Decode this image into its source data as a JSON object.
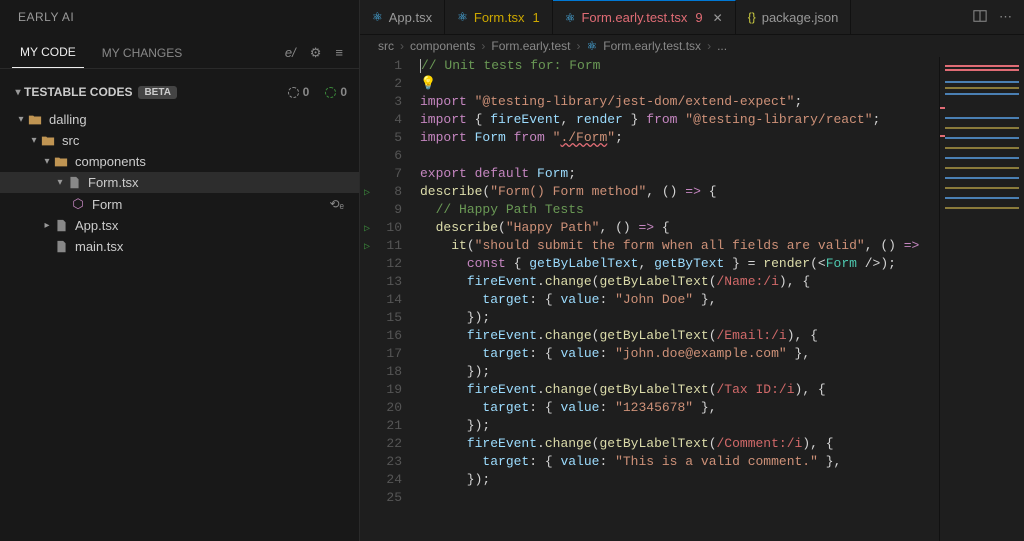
{
  "sidebar": {
    "title": "EARLY AI",
    "tabs": [
      {
        "label": "MY CODE",
        "active": true
      },
      {
        "label": "MY CHANGES",
        "active": false
      }
    ],
    "brand_glyph": "e/",
    "gear_icon": "⚙",
    "menu_icon": "≡",
    "section": {
      "title": "TESTABLE CODES",
      "badge": "BETA",
      "count_a": "0",
      "count_b": "0"
    },
    "tree": [
      {
        "label": "dalling",
        "kind": "folder",
        "depth": 1,
        "expanded": true
      },
      {
        "label": "src",
        "kind": "folder",
        "depth": 2,
        "expanded": true
      },
      {
        "label": "components",
        "kind": "folder",
        "depth": 3,
        "expanded": true
      },
      {
        "label": "Form.tsx",
        "kind": "file",
        "depth": 4,
        "expanded": true,
        "selected": true
      },
      {
        "label": "Form",
        "kind": "symbol",
        "depth": 5,
        "action": true
      },
      {
        "label": "App.tsx",
        "kind": "file",
        "depth": 3,
        "expanded": false,
        "collapsed_caret": true
      },
      {
        "label": "main.tsx",
        "kind": "file",
        "depth": 3
      }
    ]
  },
  "tabs": [
    {
      "label": "App.tsx",
      "icon": "react",
      "dirty": null
    },
    {
      "label": "Form.tsx",
      "icon": "react-mod",
      "dirty": "1"
    },
    {
      "label": "Form.early.test.tsx",
      "icon": "react-err",
      "dirty": "9",
      "active": true,
      "close": true
    },
    {
      "label": "package.json",
      "icon": "json"
    }
  ],
  "tabs_actions": {
    "split": "▣",
    "more": "⋯"
  },
  "breadcrumbs": [
    {
      "text": "src"
    },
    {
      "text": "components"
    },
    {
      "text": "Form.early.test"
    },
    {
      "text": "Form.early.test.tsx",
      "icon": "react-err"
    },
    {
      "text": "..."
    }
  ],
  "editor": {
    "lines": [
      {
        "n": 1,
        "tokens": [
          {
            "t": "// Unit tests for: Form",
            "c": "c-comment"
          }
        ],
        "cursor_before": true
      },
      {
        "n": 2,
        "tokens": [
          {
            "t": "💡",
            "c": "bulb"
          }
        ]
      },
      {
        "n": 3,
        "tokens": [
          {
            "t": "import ",
            "c": "c-kw"
          },
          {
            "t": "\"@testing-library/jest-dom/extend-expect\"",
            "c": "c-str"
          },
          {
            "t": ";",
            "c": "c-pun"
          }
        ]
      },
      {
        "n": 4,
        "tokens": [
          {
            "t": "import ",
            "c": "c-kw"
          },
          {
            "t": "{ ",
            "c": "c-pun"
          },
          {
            "t": "fireEvent",
            "c": "c-var"
          },
          {
            "t": ", ",
            "c": "c-pun"
          },
          {
            "t": "render",
            "c": "c-var"
          },
          {
            "t": " } ",
            "c": "c-pun"
          },
          {
            "t": "from ",
            "c": "c-kw"
          },
          {
            "t": "\"@testing-library/react\"",
            "c": "c-str"
          },
          {
            "t": ";",
            "c": "c-pun"
          }
        ]
      },
      {
        "n": 5,
        "tokens": [
          {
            "t": "import ",
            "c": "c-kw"
          },
          {
            "t": "Form",
            "c": "c-var"
          },
          {
            "t": " from ",
            "c": "c-kw"
          },
          {
            "t": "\"",
            "c": "c-str"
          },
          {
            "t": "./Form",
            "c": "c-str squiggle"
          },
          {
            "t": "\"",
            "c": "c-str"
          },
          {
            "t": ";",
            "c": "c-pun"
          }
        ]
      },
      {
        "n": 6,
        "tokens": []
      },
      {
        "n": 7,
        "tokens": [
          {
            "t": "export default ",
            "c": "c-kw"
          },
          {
            "t": "Form",
            "c": "c-var"
          },
          {
            "t": ";",
            "c": "c-pun"
          }
        ]
      },
      {
        "n": 8,
        "run": true,
        "tokens": [
          {
            "t": "describe",
            "c": "c-fn"
          },
          {
            "t": "(",
            "c": "c-pun"
          },
          {
            "t": "\"Form() Form method\"",
            "c": "c-str"
          },
          {
            "t": ", () ",
            "c": "c-pun"
          },
          {
            "t": "=>",
            "c": "c-kw"
          },
          {
            "t": " {",
            "c": "c-pun"
          }
        ]
      },
      {
        "n": 9,
        "tokens": [
          {
            "t": "  ",
            "c": ""
          },
          {
            "t": "// Happy Path Tests",
            "c": "c-comment"
          }
        ]
      },
      {
        "n": 10,
        "run": true,
        "tokens": [
          {
            "t": "  ",
            "c": ""
          },
          {
            "t": "describe",
            "c": "c-fn"
          },
          {
            "t": "(",
            "c": "c-pun"
          },
          {
            "t": "\"Happy Path\"",
            "c": "c-str"
          },
          {
            "t": ", () ",
            "c": "c-pun"
          },
          {
            "t": "=>",
            "c": "c-kw"
          },
          {
            "t": " {",
            "c": "c-pun"
          }
        ]
      },
      {
        "n": 11,
        "run": true,
        "tokens": [
          {
            "t": "    ",
            "c": ""
          },
          {
            "t": "it",
            "c": "c-fn"
          },
          {
            "t": "(",
            "c": "c-pun"
          },
          {
            "t": "\"should submit the form when all fields are valid\"",
            "c": "c-str"
          },
          {
            "t": ", () ",
            "c": "c-pun"
          },
          {
            "t": "=>",
            "c": "c-kw"
          }
        ]
      },
      {
        "n": 12,
        "tokens": [
          {
            "t": "      ",
            "c": ""
          },
          {
            "t": "const ",
            "c": "c-kw"
          },
          {
            "t": "{ ",
            "c": "c-pun"
          },
          {
            "t": "getByLabelText",
            "c": "c-var"
          },
          {
            "t": ", ",
            "c": "c-pun"
          },
          {
            "t": "getByText",
            "c": "c-var"
          },
          {
            "t": " } = ",
            "c": "c-pun"
          },
          {
            "t": "render",
            "c": "c-fn"
          },
          {
            "t": "(<",
            "c": "c-pun"
          },
          {
            "t": "Form",
            "c": "c-type"
          },
          {
            "t": " />);",
            "c": "c-pun"
          }
        ]
      },
      {
        "n": 13,
        "tokens": [
          {
            "t": "      ",
            "c": ""
          },
          {
            "t": "fireEvent",
            "c": "c-var"
          },
          {
            "t": ".",
            "c": "c-pun"
          },
          {
            "t": "change",
            "c": "c-fn"
          },
          {
            "t": "(",
            "c": "c-pun"
          },
          {
            "t": "getByLabelText",
            "c": "c-fn"
          },
          {
            "t": "(",
            "c": "c-pun"
          },
          {
            "t": "/Name:/i",
            "c": "c-regex"
          },
          {
            "t": "), {",
            "c": "c-pun"
          }
        ]
      },
      {
        "n": 14,
        "tokens": [
          {
            "t": "        ",
            "c": ""
          },
          {
            "t": "target",
            "c": "c-var"
          },
          {
            "t": ": { ",
            "c": "c-pun"
          },
          {
            "t": "value",
            "c": "c-var"
          },
          {
            "t": ": ",
            "c": "c-pun"
          },
          {
            "t": "\"John Doe\"",
            "c": "c-str"
          },
          {
            "t": " },",
            "c": "c-pun"
          }
        ]
      },
      {
        "n": 15,
        "tokens": [
          {
            "t": "      });",
            "c": "c-pun"
          }
        ]
      },
      {
        "n": 16,
        "tokens": [
          {
            "t": "      ",
            "c": ""
          },
          {
            "t": "fireEvent",
            "c": "c-var"
          },
          {
            "t": ".",
            "c": "c-pun"
          },
          {
            "t": "change",
            "c": "c-fn"
          },
          {
            "t": "(",
            "c": "c-pun"
          },
          {
            "t": "getByLabelText",
            "c": "c-fn"
          },
          {
            "t": "(",
            "c": "c-pun"
          },
          {
            "t": "/Email:/i",
            "c": "c-regex"
          },
          {
            "t": "), {",
            "c": "c-pun"
          }
        ]
      },
      {
        "n": 17,
        "tokens": [
          {
            "t": "        ",
            "c": ""
          },
          {
            "t": "target",
            "c": "c-var"
          },
          {
            "t": ": { ",
            "c": "c-pun"
          },
          {
            "t": "value",
            "c": "c-var"
          },
          {
            "t": ": ",
            "c": "c-pun"
          },
          {
            "t": "\"john.doe@example.com\"",
            "c": "c-str"
          },
          {
            "t": " },",
            "c": "c-pun"
          }
        ]
      },
      {
        "n": 18,
        "tokens": [
          {
            "t": "      });",
            "c": "c-pun"
          }
        ]
      },
      {
        "n": 19,
        "tokens": [
          {
            "t": "      ",
            "c": ""
          },
          {
            "t": "fireEvent",
            "c": "c-var"
          },
          {
            "t": ".",
            "c": "c-pun"
          },
          {
            "t": "change",
            "c": "c-fn"
          },
          {
            "t": "(",
            "c": "c-pun"
          },
          {
            "t": "getByLabelText",
            "c": "c-fn"
          },
          {
            "t": "(",
            "c": "c-pun"
          },
          {
            "t": "/Tax ID:/i",
            "c": "c-regex"
          },
          {
            "t": "), {",
            "c": "c-pun"
          }
        ]
      },
      {
        "n": 20,
        "tokens": [
          {
            "t": "        ",
            "c": ""
          },
          {
            "t": "target",
            "c": "c-var"
          },
          {
            "t": ": { ",
            "c": "c-pun"
          },
          {
            "t": "value",
            "c": "c-var"
          },
          {
            "t": ": ",
            "c": "c-pun"
          },
          {
            "t": "\"12345678\"",
            "c": "c-str"
          },
          {
            "t": " },",
            "c": "c-pun"
          }
        ]
      },
      {
        "n": 21,
        "tokens": [
          {
            "t": "      });",
            "c": "c-pun"
          }
        ]
      },
      {
        "n": 22,
        "tokens": [
          {
            "t": "      ",
            "c": ""
          },
          {
            "t": "fireEvent",
            "c": "c-var"
          },
          {
            "t": ".",
            "c": "c-pun"
          },
          {
            "t": "change",
            "c": "c-fn"
          },
          {
            "t": "(",
            "c": "c-pun"
          },
          {
            "t": "getByLabelText",
            "c": "c-fn"
          },
          {
            "t": "(",
            "c": "c-pun"
          },
          {
            "t": "/Comment:/i",
            "c": "c-regex"
          },
          {
            "t": "), {",
            "c": "c-pun"
          }
        ]
      },
      {
        "n": 23,
        "tokens": [
          {
            "t": "        ",
            "c": ""
          },
          {
            "t": "target",
            "c": "c-var"
          },
          {
            "t": ": { ",
            "c": "c-pun"
          },
          {
            "t": "value",
            "c": "c-var"
          },
          {
            "t": ": ",
            "c": "c-pun"
          },
          {
            "t": "\"This is a valid comment.\"",
            "c": "c-str"
          },
          {
            "t": " },",
            "c": "c-pun"
          }
        ]
      },
      {
        "n": 24,
        "tokens": [
          {
            "t": "      });",
            "c": "c-pun"
          }
        ]
      },
      {
        "n": 25,
        "tokens": []
      }
    ]
  }
}
